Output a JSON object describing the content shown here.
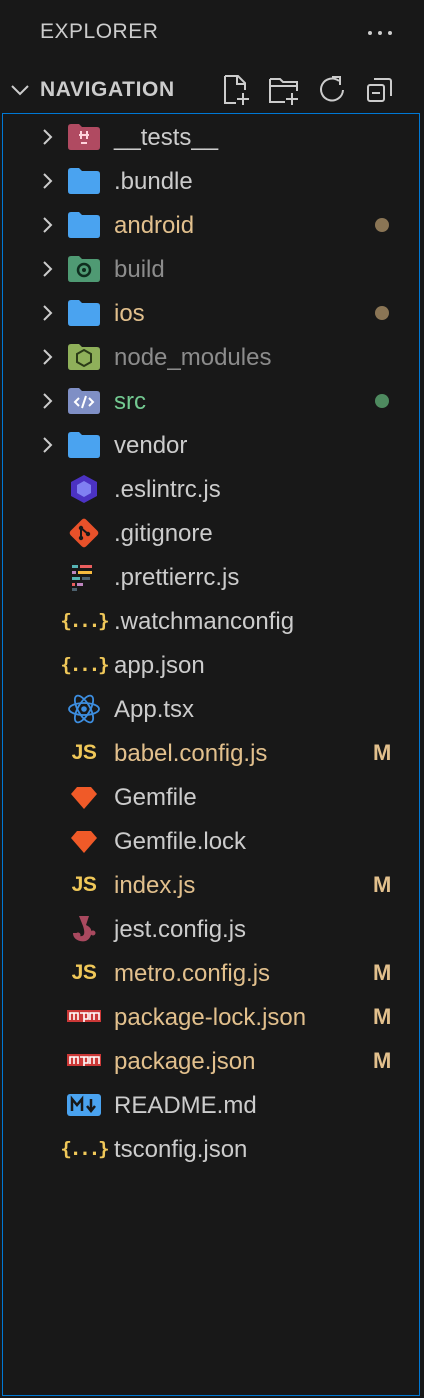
{
  "panel": {
    "title": "EXPLORER",
    "more_actions": "···"
  },
  "section": {
    "title": "NAVIGATION",
    "actions": [
      "new-file",
      "new-folder",
      "refresh",
      "collapse-all"
    ]
  },
  "colors": {
    "background": "#181818",
    "focus_border": "#0078d4",
    "modified": "#e2c08d",
    "untracked_green": "#73c991",
    "ignored": "#8c8c8c",
    "folder_blue": "#4aa3f0"
  },
  "tree": {
    "items": [
      {
        "label": "__tests__",
        "type": "folder",
        "icon": "tests-folder-icon",
        "color": "#cccccc",
        "badge": ""
      },
      {
        "label": ".bundle",
        "type": "folder",
        "icon": "folder-icon",
        "color": "#cccccc",
        "badge": ""
      },
      {
        "label": "android",
        "type": "folder",
        "icon": "folder-icon",
        "color": "#e2c08d",
        "badge": "dot"
      },
      {
        "label": "build",
        "type": "folder",
        "icon": "build-folder-icon",
        "color": "#8c8c8c",
        "badge": ""
      },
      {
        "label": "ios",
        "type": "folder",
        "icon": "folder-icon",
        "color": "#e2c08d",
        "badge": "dot"
      },
      {
        "label": "node_modules",
        "type": "folder",
        "icon": "node-folder-icon",
        "color": "#8c8c8c",
        "badge": ""
      },
      {
        "label": "src",
        "type": "folder",
        "icon": "src-folder-icon",
        "color": "#73c991",
        "badge": "dot-green"
      },
      {
        "label": "vendor",
        "type": "folder",
        "icon": "folder-icon",
        "color": "#cccccc",
        "badge": ""
      },
      {
        "label": ".eslintrc.js",
        "type": "file",
        "icon": "eslint-icon",
        "color": "#cccccc",
        "badge": ""
      },
      {
        "label": ".gitignore",
        "type": "file",
        "icon": "git-icon",
        "color": "#cccccc",
        "badge": ""
      },
      {
        "label": ".prettierrc.js",
        "type": "file",
        "icon": "prettier-icon",
        "color": "#cccccc",
        "badge": ""
      },
      {
        "label": ".watchmanconfig",
        "type": "file",
        "icon": "json-braces-icon",
        "color": "#cccccc",
        "badge": ""
      },
      {
        "label": "app.json",
        "type": "file",
        "icon": "json-braces-icon",
        "color": "#cccccc",
        "badge": ""
      },
      {
        "label": "App.tsx",
        "type": "file",
        "icon": "react-icon",
        "color": "#cccccc",
        "badge": ""
      },
      {
        "label": "babel.config.js",
        "type": "file",
        "icon": "javascript-icon",
        "color": "#e2c08d",
        "badge": "M"
      },
      {
        "label": "Gemfile",
        "type": "file",
        "icon": "ruby-gem-icon",
        "color": "#cccccc",
        "badge": ""
      },
      {
        "label": "Gemfile.lock",
        "type": "file",
        "icon": "ruby-gem-icon",
        "color": "#cccccc",
        "badge": ""
      },
      {
        "label": "index.js",
        "type": "file",
        "icon": "javascript-icon",
        "color": "#e2c08d",
        "badge": "M"
      },
      {
        "label": "jest.config.js",
        "type": "file",
        "icon": "jest-icon",
        "color": "#cccccc",
        "badge": ""
      },
      {
        "label": "metro.config.js",
        "type": "file",
        "icon": "javascript-icon",
        "color": "#e2c08d",
        "badge": "M"
      },
      {
        "label": "package-lock.json",
        "type": "file",
        "icon": "npm-icon",
        "color": "#e2c08d",
        "badge": "M"
      },
      {
        "label": "package.json",
        "type": "file",
        "icon": "npm-icon",
        "color": "#e2c08d",
        "badge": "M"
      },
      {
        "label": "README.md",
        "type": "file",
        "icon": "markdown-icon",
        "color": "#cccccc",
        "badge": ""
      },
      {
        "label": "tsconfig.json",
        "type": "file",
        "icon": "json-braces-icon",
        "color": "#cccccc",
        "badge": ""
      }
    ]
  }
}
